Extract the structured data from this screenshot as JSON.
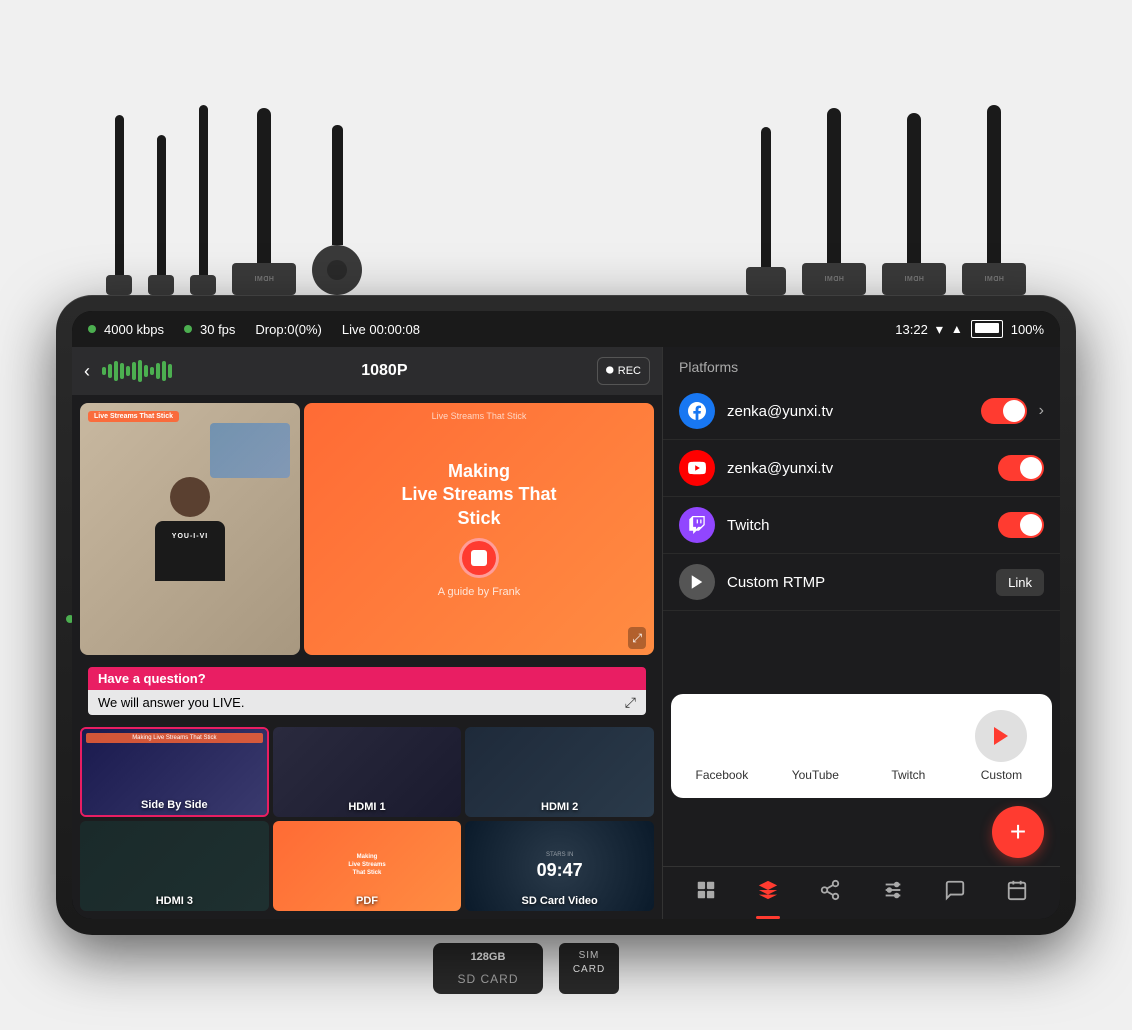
{
  "device": {
    "status_bar": {
      "bitrate": "4000 kbps",
      "fps": "30 fps",
      "drop": "Drop:0(0%)",
      "live_time": "Live 00:00:08",
      "clock": "13:22",
      "battery": "100%"
    },
    "left_panel": {
      "resolution": "1080P",
      "back_label": "‹",
      "rec_label": "REC",
      "question_text": "Have a question?",
      "answer_text": "We will answer you LIVE.",
      "thumbnails": [
        {
          "label": "Side By Side",
          "selected": true,
          "type": "person"
        },
        {
          "label": "HDMI 1",
          "selected": false,
          "type": "person"
        },
        {
          "label": "HDMI 2",
          "selected": false,
          "type": "person"
        },
        {
          "label": "HDMI 3",
          "selected": false,
          "type": "person"
        },
        {
          "label": "PDF",
          "selected": false,
          "type": "orange"
        },
        {
          "label": "SD Card Video",
          "selected": false,
          "type": "dark"
        }
      ]
    },
    "right_panel": {
      "platforms_header": "Platforms",
      "platforms": [
        {
          "name": "zenka@yunxi.tv",
          "type": "facebook",
          "enabled": true,
          "has_chevron": true
        },
        {
          "name": "zenka@yunxi.tv",
          "type": "youtube",
          "enabled": true,
          "has_chevron": false
        },
        {
          "name": "Twitch",
          "type": "twitch",
          "enabled": true,
          "has_chevron": false
        },
        {
          "name": "Custom RTMP",
          "type": "custom",
          "enabled": false,
          "has_chevron": false,
          "has_link": true
        }
      ],
      "platform_selector": {
        "items": [
          {
            "label": "Facebook",
            "type": "facebook"
          },
          {
            "label": "YouTube",
            "type": "youtube"
          },
          {
            "label": "Twitch",
            "type": "twitch"
          },
          {
            "label": "Custom",
            "type": "custom"
          }
        ]
      },
      "link_label": "Link",
      "fab_icon": "+"
    },
    "bottom_nav": {
      "items": [
        {
          "icon": "⊞",
          "active": false
        },
        {
          "icon": "◈",
          "active": true
        },
        {
          "icon": "⇄",
          "active": false
        },
        {
          "icon": "⚙",
          "active": false
        },
        {
          "icon": "💬",
          "active": false
        },
        {
          "icon": "📅",
          "active": false
        }
      ]
    }
  },
  "bottom_cards": {
    "sd_card": {
      "capacity": "128",
      "unit": "GB",
      "label": "SD CARD"
    },
    "sim_card": {
      "label": "SIM\nCARD"
    }
  },
  "preview_content": {
    "title_line1": "Making",
    "title_line2": "Live Streams That",
    "title_line3": "Stick",
    "subtitle": "A guide by Frank",
    "overlay_top": "Live Streams That Stick",
    "time_display": "09:47",
    "stars_label": "STARS IN"
  }
}
